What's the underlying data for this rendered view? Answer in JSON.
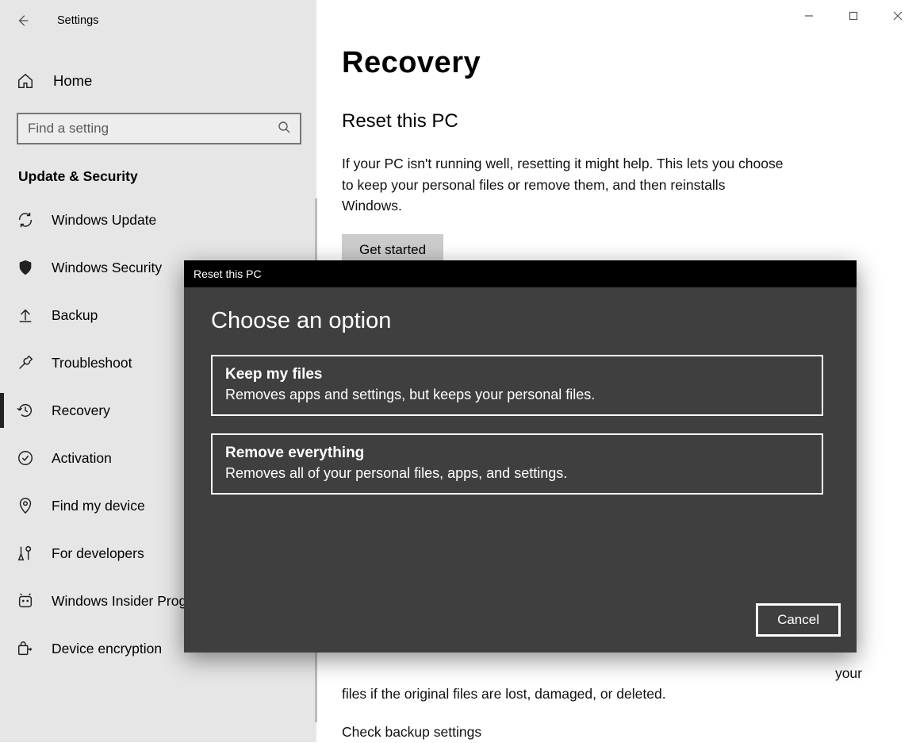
{
  "window": {
    "app_name": "Settings"
  },
  "sidebar": {
    "home": "Home",
    "search_placeholder": "Find a setting",
    "section": "Update & Security",
    "items": [
      {
        "label": "Windows Update"
      },
      {
        "label": "Windows Security"
      },
      {
        "label": "Backup"
      },
      {
        "label": "Troubleshoot"
      },
      {
        "label": "Recovery"
      },
      {
        "label": "Activation"
      },
      {
        "label": "Find my device"
      },
      {
        "label": "For developers"
      },
      {
        "label": "Windows Insider Program"
      },
      {
        "label": "Device encryption"
      }
    ]
  },
  "main": {
    "title": "Recovery",
    "reset_heading": "Reset this PC",
    "reset_body": "If your PC isn't running well, resetting it might help. This lets you choose to keep your personal files or remove them, and then reinstalls Windows.",
    "get_started": "Get started",
    "below_text_1": "files if the original files are lost, damaged, or deleted.",
    "below_text_2": "Check backup settings",
    "below_tail": "your"
  },
  "modal": {
    "title": "Reset this PC",
    "heading": "Choose an option",
    "options": [
      {
        "title": "Keep my files",
        "desc": "Removes apps and settings, but keeps your personal files."
      },
      {
        "title": "Remove everything",
        "desc": "Removes all of your personal files, apps, and settings."
      }
    ],
    "cancel": "Cancel"
  }
}
